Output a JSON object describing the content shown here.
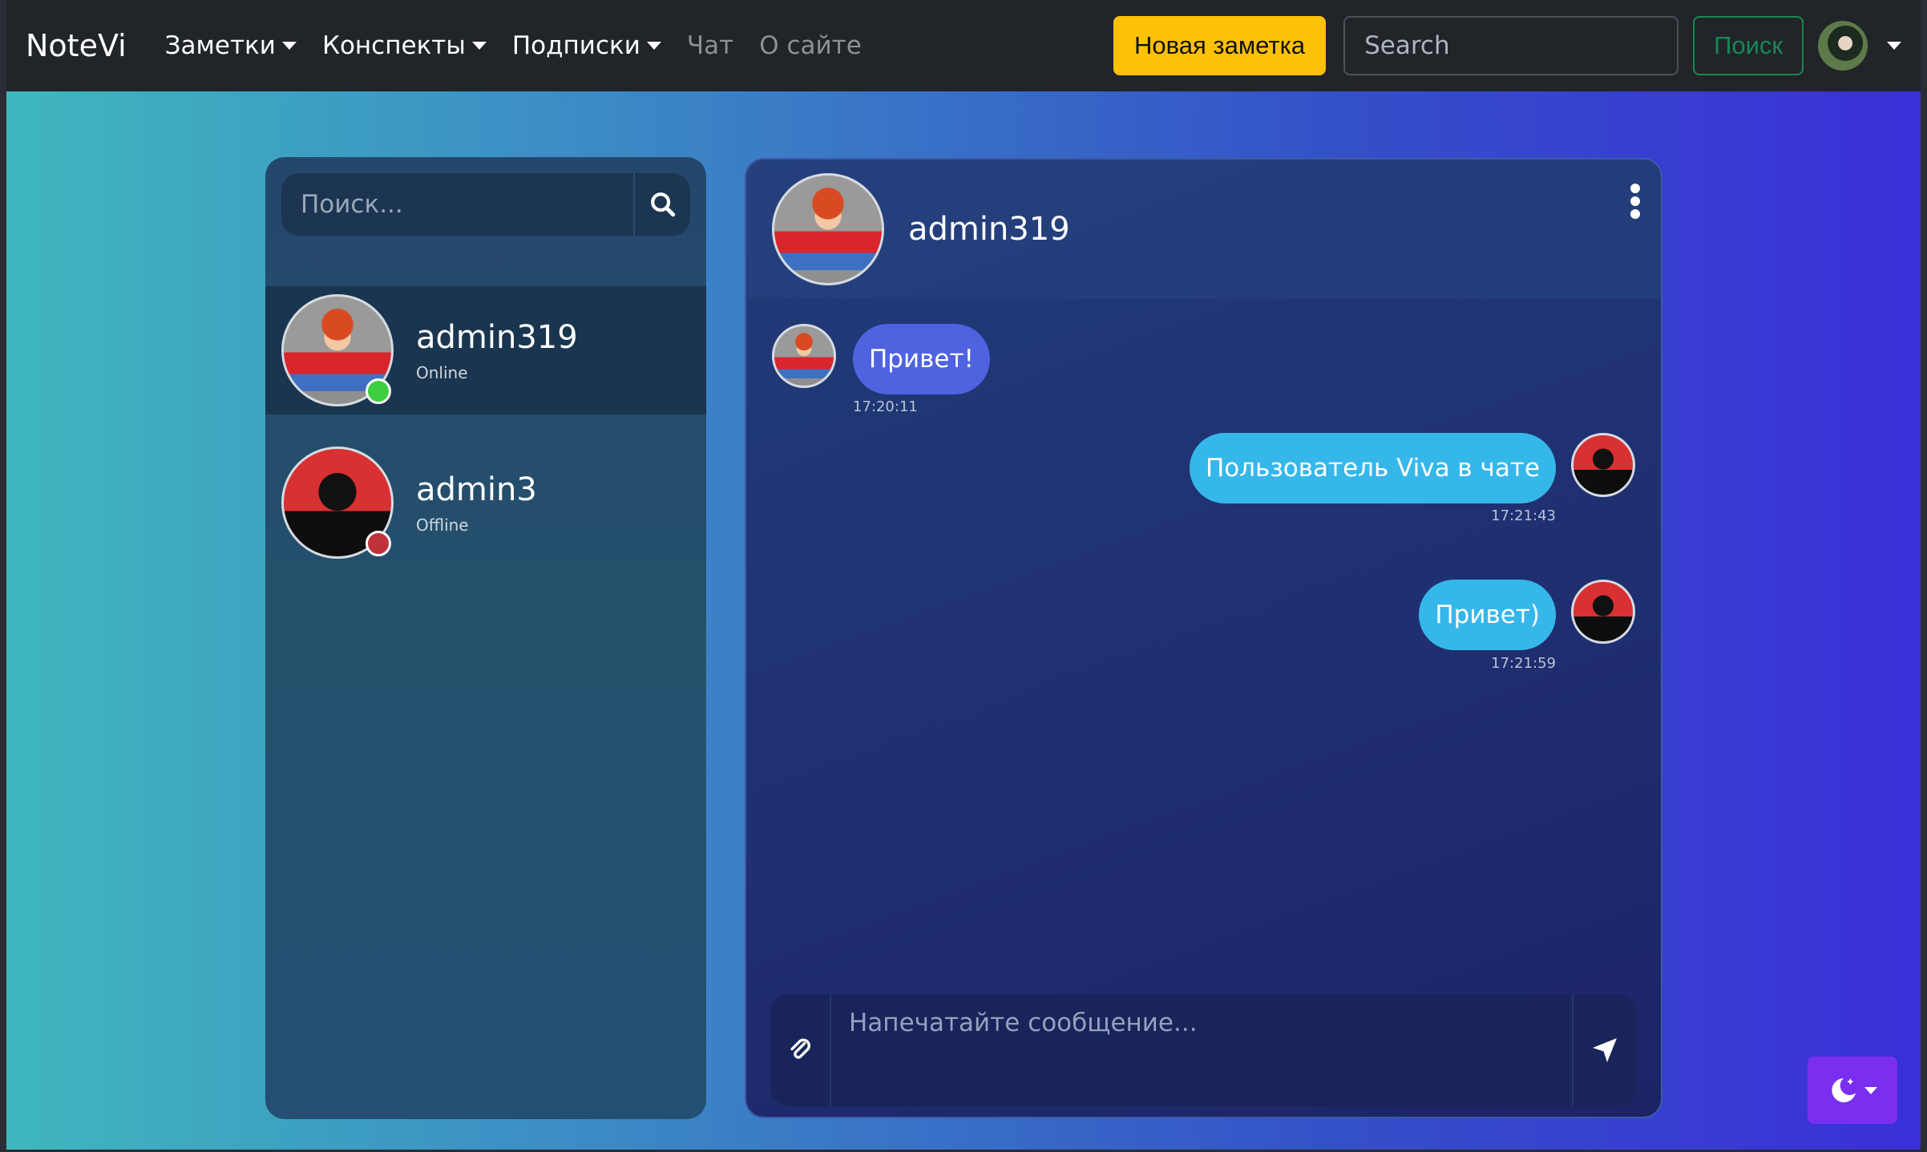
{
  "navbar": {
    "brand": "NoteVi",
    "items": [
      {
        "label": "Заметки",
        "dropdown": true
      },
      {
        "label": "Конспекты",
        "dropdown": true
      },
      {
        "label": "Подписки",
        "dropdown": true
      },
      {
        "label": "Чат",
        "dropdown": false
      },
      {
        "label": "О сайте",
        "dropdown": false
      }
    ],
    "new_note_label": "Новая заметка",
    "search_placeholder": "Search",
    "search_button": "Поиск",
    "accent": "#ffc107",
    "search_btn_color": "#198754"
  },
  "sidebar": {
    "search_placeholder": "Поиск...",
    "contacts": [
      {
        "name": "admin319",
        "status": "Online",
        "status_color": "#3ecf3e",
        "avatar": "cartoon-boy-avatar"
      },
      {
        "name": "admin3",
        "status": "Offline",
        "status_color": "#c0323a",
        "avatar": "lock-suit-avatar"
      }
    ]
  },
  "chat": {
    "header_name": "admin319",
    "messages": [
      {
        "direction": "in",
        "text": "Привет!",
        "time": "17:20:11"
      },
      {
        "direction": "out",
        "text": "Пользователь Viva в чате",
        "time": "17:21:43"
      },
      {
        "direction": "out",
        "text": "Привет)",
        "time": "17:21:59"
      }
    ],
    "composer_placeholder": "Напечатайте сообщение..."
  },
  "colors": {
    "incoming_bubble": "#4f63e0",
    "outgoing_bubble": "#36b7ea",
    "theme_button": "#7a2ef0"
  },
  "icons": {
    "search": "search-icon",
    "attach": "paperclip-icon",
    "send": "send-arrow-icon",
    "menu": "kebab-menu-icon",
    "theme": "moon-stars-icon"
  }
}
